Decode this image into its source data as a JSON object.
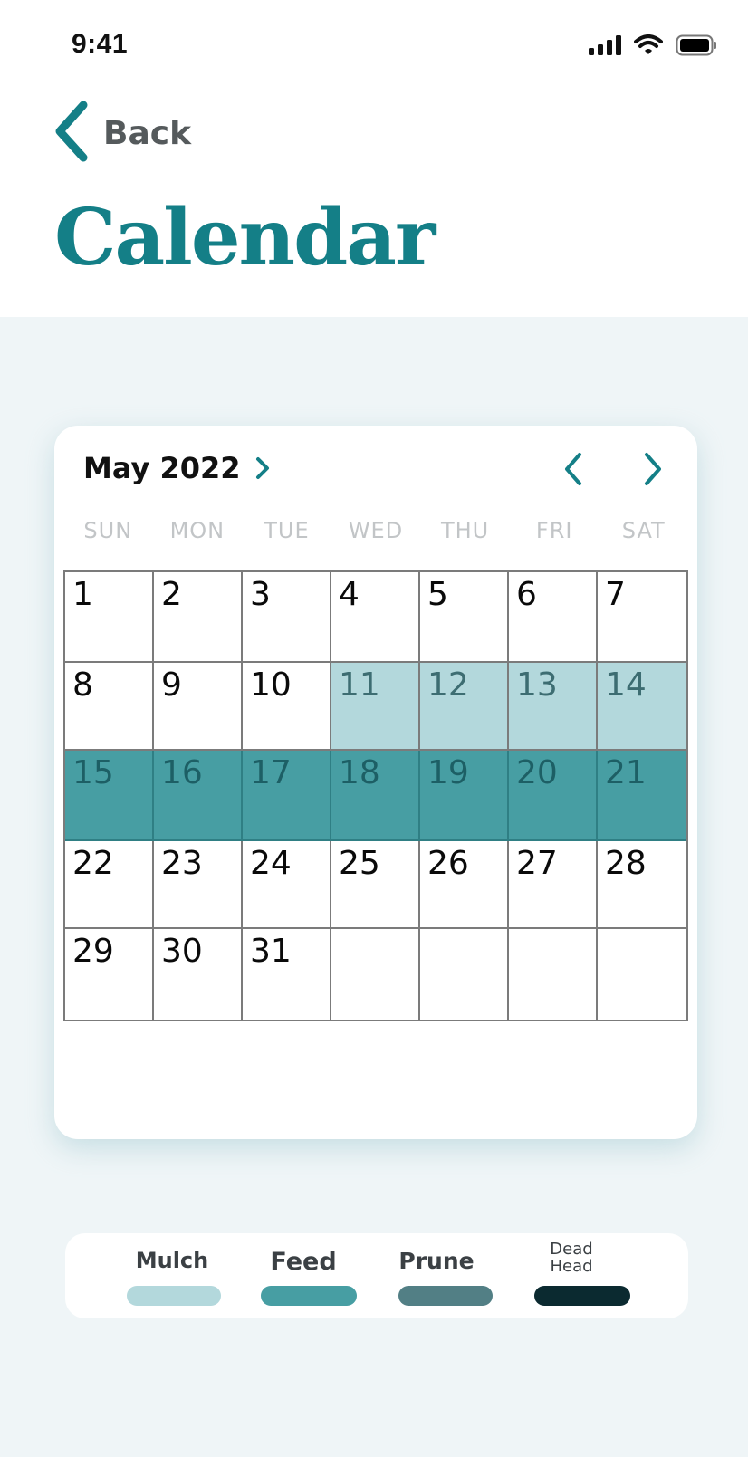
{
  "status_bar": {
    "time": "9:41"
  },
  "nav": {
    "back_label": "Back"
  },
  "page": {
    "title": "Calendar"
  },
  "calendar": {
    "month_label": "May 2022",
    "weekdays": [
      "SUN",
      "MON",
      "TUE",
      "WED",
      "THU",
      "FRI",
      "SAT"
    ],
    "days": [
      "1",
      "2",
      "3",
      "4",
      "5",
      "6",
      "7",
      "8",
      "9",
      "10",
      "11",
      "12",
      "13",
      "14",
      "15",
      "16",
      "17",
      "18",
      "19",
      "20",
      "21",
      "22",
      "23",
      "24",
      "25",
      "26",
      "27",
      "28",
      "29",
      "30",
      "31",
      "",
      "",
      "",
      ""
    ],
    "highlights": {
      "mulch": [
        "11",
        "12",
        "13",
        "14"
      ],
      "feed": [
        "15",
        "16",
        "17",
        "18",
        "19",
        "20",
        "21"
      ]
    }
  },
  "legend": {
    "mulch": {
      "label": "Mulch",
      "color": "#b3d8dc"
    },
    "feed": {
      "label": "Feed",
      "color": "#479ea3"
    },
    "prune": {
      "label": "Prune",
      "color": "#527f85"
    },
    "deadhead": {
      "label_line1": "Dead",
      "label_line2": "Head",
      "color": "#0b2a30"
    }
  },
  "colors": {
    "accent": "#147f87",
    "background": "#eff5f7"
  }
}
